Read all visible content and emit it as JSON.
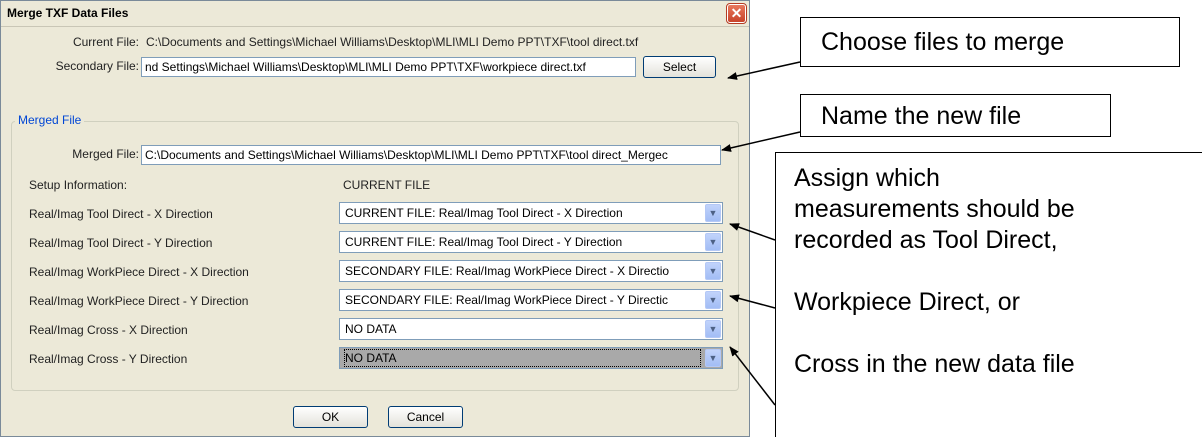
{
  "dialog": {
    "title": "Merge TXF Data Files",
    "close_glyph": "✕",
    "current_file_label": "Current File:",
    "current_file_value": "C:\\Documents and Settings\\Michael Williams\\Desktop\\MLI\\MLI Demo PPT\\TXF\\tool direct.txf",
    "secondary_file_label": "Secondary File:",
    "secondary_file_value": "nd Settings\\Michael Williams\\Desktop\\MLI\\MLI Demo PPT\\TXF\\workpiece direct.txf",
    "select_button": "Select",
    "merged_group_title": "Merged File",
    "merged_file_label": "Merged File:",
    "merged_file_value": "C:\\Documents and Settings\\Michael Williams\\Desktop\\MLI\\MLI Demo PPT\\TXF\\tool direct_Mergec",
    "setup_label": "Setup Information:",
    "setup_value": "CURRENT FILE",
    "rows": [
      {
        "label": "Real/Imag Tool Direct - X Direction",
        "selected": "CURRENT FILE: Real/Imag Tool Direct - X Direction"
      },
      {
        "label": "Real/Imag Tool Direct - Y Direction",
        "selected": "CURRENT FILE: Real/Imag Tool Direct - Y Direction"
      },
      {
        "label": "Real/Imag WorkPiece Direct - X Direction",
        "selected": "SECONDARY FILE:  Real/Imag WorkPiece Direct - X Directio"
      },
      {
        "label": "Real/Imag WorkPiece Direct - Y Direction",
        "selected": "SECONDARY FILE:  Real/Imag WorkPiece Direct - Y Directic"
      },
      {
        "label": "Real/Imag Cross - X Direction",
        "selected": "NO DATA"
      },
      {
        "label": "Real/Imag Cross - Y Direction",
        "selected": "NO DATA"
      }
    ],
    "dropdown_glyph": "▼",
    "ok_button": "OK",
    "cancel_button": "Cancel"
  },
  "callouts": {
    "choose_files": "Choose files to merge",
    "name_file": "Name the new file",
    "assign_lines": [
      "Assign which",
      "measurements should be",
      "recorded as Tool Direct,",
      "Workpiece Direct, or",
      "Cross in the new data file"
    ]
  },
  "colors": {
    "dialog_bg": "#ece9d8",
    "group_title": "#0046d5",
    "close_button": "#c8432a",
    "field_border": "#7f9db9",
    "disabled_combo": "#a9a9a9"
  }
}
